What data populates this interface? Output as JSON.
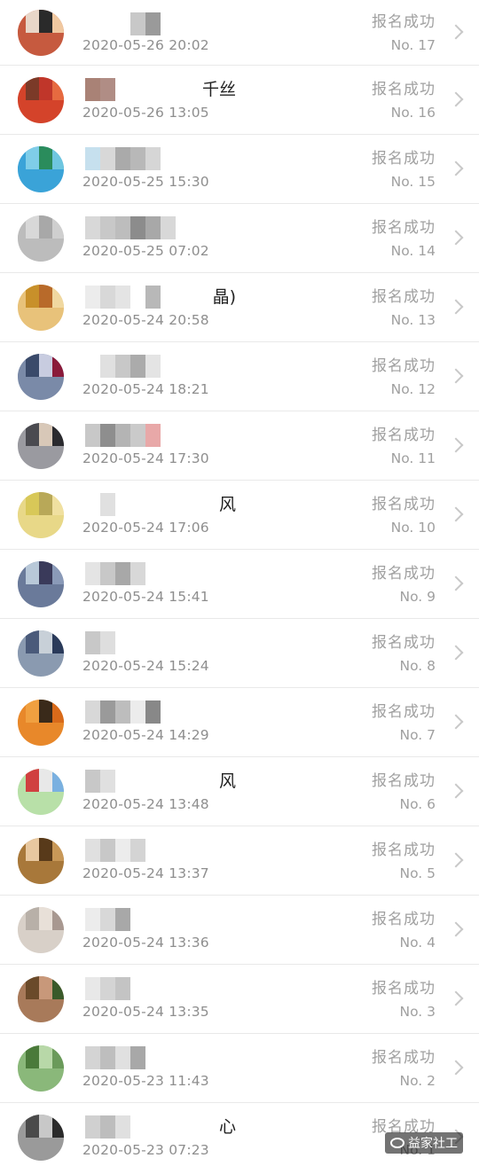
{
  "rows": [
    {
      "name": "",
      "time": "2020-05-26 20:02",
      "status": "报名成功",
      "no": "No. 17",
      "avatar_colors": [
        "#c65a3f",
        "#e8d6c8",
        "#2a2a2a",
        "#f0c8a0"
      ],
      "name_colors": [
        "#ffffff",
        "#ffffff",
        "#ffffff",
        "#c8c8c8",
        "#9a9a9a"
      ]
    },
    {
      "name": "千丝",
      "time": "2020-05-26 13:05",
      "status": "报名成功",
      "no": "No. 16",
      "avatar_colors": [
        "#d4432a",
        "#7b3a28",
        "#c0362a",
        "#e66a40"
      ],
      "name_colors": [
        "#a98276",
        "#b08d85",
        "#ffffff"
      ]
    },
    {
      "name": "",
      "time": "2020-05-25 15:30",
      "status": "报名成功",
      "no": "No. 15",
      "avatar_colors": [
        "#3aa3d8",
        "#7fcde8",
        "#2a8c5c",
        "#6ec6e0"
      ],
      "name_colors": [
        "#c6e0ee",
        "#d8d8d8",
        "#aaaaaa",
        "#b8b8b8",
        "#d6d6d6"
      ]
    },
    {
      "name": "",
      "time": "2020-05-25 07:02",
      "status": "报名成功",
      "no": "No. 14",
      "avatar_colors": [
        "#bcbcbc",
        "#d8d8d8",
        "#a8a8a8",
        "#cfcfcf"
      ],
      "name_colors": [
        "#d8d8d8",
        "#c8c8c8",
        "#bdbdbd",
        "#8c8c8c",
        "#a8a8a8",
        "#d8d8d8"
      ]
    },
    {
      "name": "晶)",
      "time": "2020-05-24 20:58",
      "status": "报名成功",
      "no": "No. 13",
      "avatar_colors": [
        "#e8c27a",
        "#c8902a",
        "#b86a2a",
        "#f0d8a0"
      ],
      "name_colors": [
        "#ececec",
        "#d8d8d8",
        "#e4e4e4",
        "#ffffff",
        "#b8b8b8"
      ]
    },
    {
      "name": "",
      "time": "2020-05-24 18:21",
      "status": "报名成功",
      "no": "No. 12",
      "avatar_colors": [
        "#7a8aa8",
        "#3a4a6a",
        "#c8cce0",
        "#8a1a3a"
      ],
      "name_colors": [
        "#ffffff",
        "#e0e0e0",
        "#c8c8c8",
        "#ababab",
        "#e4e4e4"
      ]
    },
    {
      "name": "",
      "time": "2020-05-24 17:30",
      "status": "报名成功",
      "no": "No. 11",
      "avatar_colors": [
        "#9a9aa0",
        "#4a4a50",
        "#d8c8b8",
        "#2a2a2e"
      ],
      "name_colors": [
        "#c8c8c8",
        "#8e8e8e",
        "#b4b4b4",
        "#cacaca",
        "#e8a8a8"
      ]
    },
    {
      "name": "风",
      "time": "2020-05-24 17:06",
      "status": "报名成功",
      "no": "No. 10",
      "avatar_colors": [
        "#e8d888",
        "#d8c858",
        "#b8a858",
        "#f0e0a0"
      ],
      "name_colors": [
        "#ffffff",
        "#e0e0e0"
      ]
    },
    {
      "name": "",
      "time": "2020-05-24 15:41",
      "status": "报名成功",
      "no": "No. 9",
      "avatar_colors": [
        "#6a7a9a",
        "#b8c8d8",
        "#3a3a5a",
        "#8a9ab8"
      ],
      "name_colors": [
        "#e4e4e4",
        "#c8c8c8",
        "#a8a8a8",
        "#d8d8d8"
      ]
    },
    {
      "name": "",
      "time": "2020-05-24 15:24",
      "status": "报名成功",
      "no": "No. 8",
      "avatar_colors": [
        "#8a9ab0",
        "#4a5a7a",
        "#c8d0d8",
        "#2a3a5a"
      ],
      "name_colors": [
        "#c8c8c8",
        "#dedede",
        "#ffffff"
      ]
    },
    {
      "name": "",
      "time": "2020-05-24 14:29",
      "status": "报名成功",
      "no": "No. 7",
      "avatar_colors": [
        "#e8882a",
        "#f0a040",
        "#3a2a1a",
        "#d86a1a"
      ],
      "name_colors": [
        "#d8d8d8",
        "#9a9a9a",
        "#bdbdbd",
        "#ececec",
        "#888888"
      ]
    },
    {
      "name": "风",
      "time": "2020-05-24 13:48",
      "status": "报名成功",
      "no": "No. 6",
      "avatar_colors": [
        "#b8e0a8",
        "#d04040",
        "#e8e8e8",
        "#7ab0e0"
      ],
      "name_colors": [
        "#c8c8c8",
        "#e0e0e0"
      ]
    },
    {
      "name": "",
      "time": "2020-05-24 13:37",
      "status": "报名成功",
      "no": "No. 5",
      "avatar_colors": [
        "#a8783a",
        "#e8c8a0",
        "#583a1a",
        "#c89858"
      ],
      "name_colors": [
        "#e0e0e0",
        "#c8c8c8",
        "#ececec",
        "#d4d4d4"
      ]
    },
    {
      "name": "",
      "time": "2020-05-24 13:36",
      "status": "报名成功",
      "no": "No. 4",
      "avatar_colors": [
        "#d8d0c8",
        "#b8b0a8",
        "#e8e0d8",
        "#a89890"
      ],
      "name_colors": [
        "#ececec",
        "#d8d8d8",
        "#a8a8a8"
      ]
    },
    {
      "name": "",
      "time": "2020-05-24 13:35",
      "status": "报名成功",
      "no": "No. 3",
      "avatar_colors": [
        "#a87a5a",
        "#6a4a2a",
        "#c8987a",
        "#3a5a2a"
      ],
      "name_colors": [
        "#e8e8e8",
        "#d4d4d4",
        "#c4c4c4"
      ]
    },
    {
      "name": "",
      "time": "2020-05-23 11:43",
      "status": "报名成功",
      "no": "No. 2",
      "avatar_colors": [
        "#8ab87a",
        "#4a7a3a",
        "#b8d8a8",
        "#6a9a5a"
      ],
      "name_colors": [
        "#d4d4d4",
        "#bebebe",
        "#e0e0e0",
        "#a8a8a8"
      ]
    },
    {
      "name": "心",
      "time": "2020-05-23 07:23",
      "status": "报名成功",
      "no": "No. 1",
      "avatar_colors": [
        "#9a9a9a",
        "#4a4a4a",
        "#c8c8c8",
        "#2a2a2a"
      ],
      "name_colors": [
        "#d0d0d0",
        "#bdbdbd",
        "#e0e0e0"
      ]
    }
  ],
  "watermark": "益家社工"
}
